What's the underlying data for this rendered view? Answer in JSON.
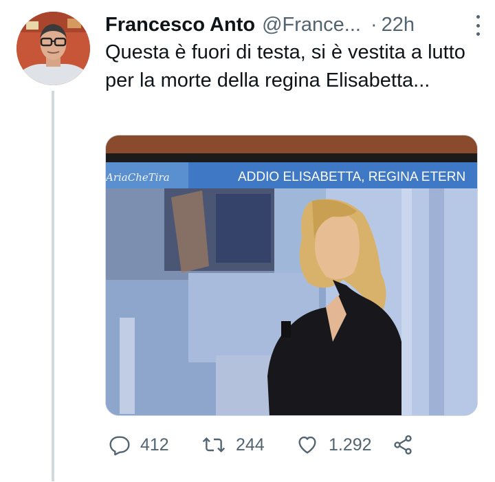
{
  "tweet": {
    "author_name": "Francesco Anto",
    "handle": "@France...",
    "separator": "·",
    "time": "22h",
    "text": "Questa è fuori di testa, si è vestita a lutto per la morte della regina Elisabetta...",
    "media": {
      "tv_banner_text": "ADDIO ELISABETTA, REGINA ETERN",
      "show_logo_text": "AriaCheTira"
    },
    "actions": {
      "replies": "412",
      "retweets": "244",
      "likes": "1.292"
    }
  },
  "icons": {
    "reply": "reply-icon",
    "retweet": "retweet-icon",
    "like": "heart-icon",
    "share": "share-icon",
    "more": "more-icon"
  },
  "colors": {
    "text": "#0f1419",
    "secondary": "#536471",
    "thread_line": "#cfd9de"
  }
}
